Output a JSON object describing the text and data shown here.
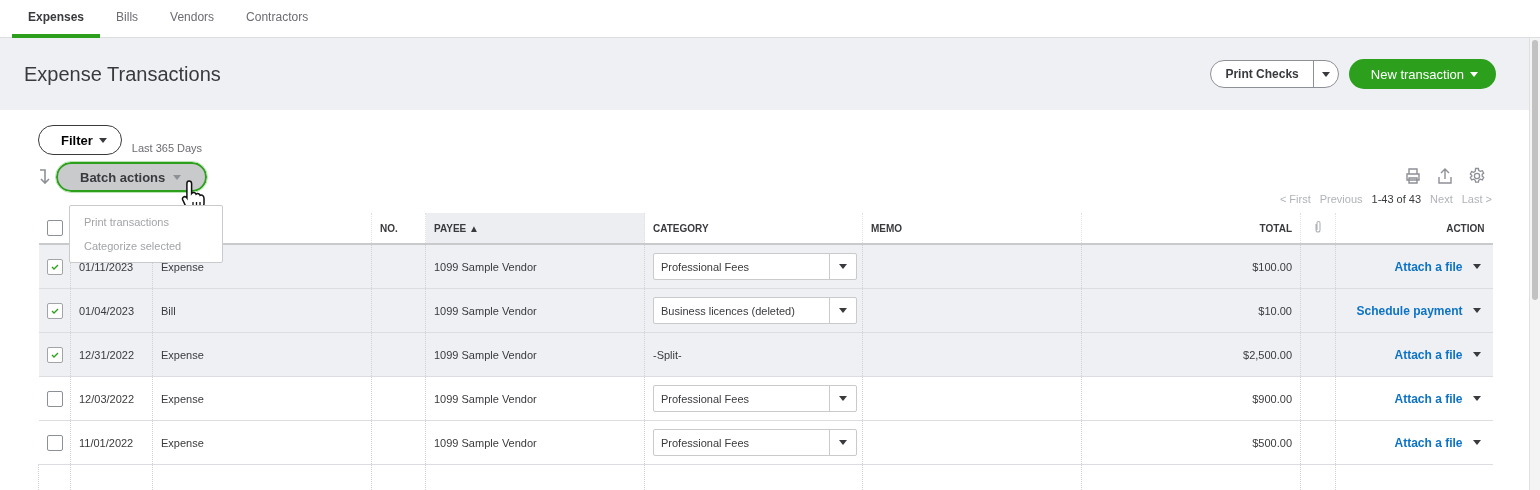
{
  "tabs": [
    {
      "label": "Expenses",
      "selected": true
    },
    {
      "label": "Bills",
      "selected": false
    },
    {
      "label": "Vendors",
      "selected": false
    },
    {
      "label": "Contractors",
      "selected": false
    }
  ],
  "page_title": "Expense Transactions",
  "header_buttons": {
    "print_checks": "Print Checks",
    "new_transaction": "New transaction"
  },
  "filter": {
    "button": "Filter",
    "range": "Last 365 Days"
  },
  "batch_actions": {
    "button": "Batch actions",
    "expanded": true,
    "menu": [
      {
        "label": "Print transactions",
        "disabled": true
      },
      {
        "label": "Categorize selected",
        "disabled": true
      }
    ]
  },
  "pagination": {
    "first": "< First",
    "previous": "Previous",
    "range": "1-43 of 43",
    "next": "Next",
    "last": "Last >"
  },
  "table": {
    "select_all": {
      "checked": false
    },
    "columns": [
      {
        "label": "NO.",
        "sorted": false
      },
      {
        "label": "PAYEE ▲",
        "sorted": true
      },
      {
        "label": "CATEGORY",
        "sorted": false
      },
      {
        "label": "MEMO",
        "sorted": false
      },
      {
        "label": "TOTAL",
        "sorted": false
      },
      {
        "label": "ACTION",
        "sorted": false
      }
    ],
    "rows": [
      {
        "selected": true,
        "date": "01/11/2023",
        "type": "Expense",
        "payee": "1099 Sample Vendor",
        "category": {
          "kind": "dropdown",
          "text": "Professional Fees"
        },
        "total": "$100.00",
        "action": "Attach a file"
      },
      {
        "selected": true,
        "date": "01/04/2023",
        "type": "Bill",
        "payee": "1099 Sample Vendor",
        "category": {
          "kind": "dropdown",
          "text": "Business licences (deleted)"
        },
        "total": "$10.00",
        "action": "Schedule payment"
      },
      {
        "selected": true,
        "date": "12/31/2022",
        "type": "Expense",
        "payee": "1099 Sample Vendor",
        "category": {
          "kind": "text",
          "text": "-Split-"
        },
        "total": "$2,500.00",
        "action": "Attach a file"
      },
      {
        "selected": false,
        "date": "12/03/2022",
        "type": "Expense",
        "payee": "1099 Sample Vendor",
        "category": {
          "kind": "dropdown",
          "text": "Professional Fees"
        },
        "total": "$900.00",
        "action": "Attach a file"
      },
      {
        "selected": false,
        "date": "11/01/2022",
        "type": "Expense",
        "payee": "1099 Sample Vendor",
        "category": {
          "kind": "dropdown",
          "text": "Professional Fees"
        },
        "total": "$500.00",
        "action": "Attach a file"
      }
    ]
  }
}
